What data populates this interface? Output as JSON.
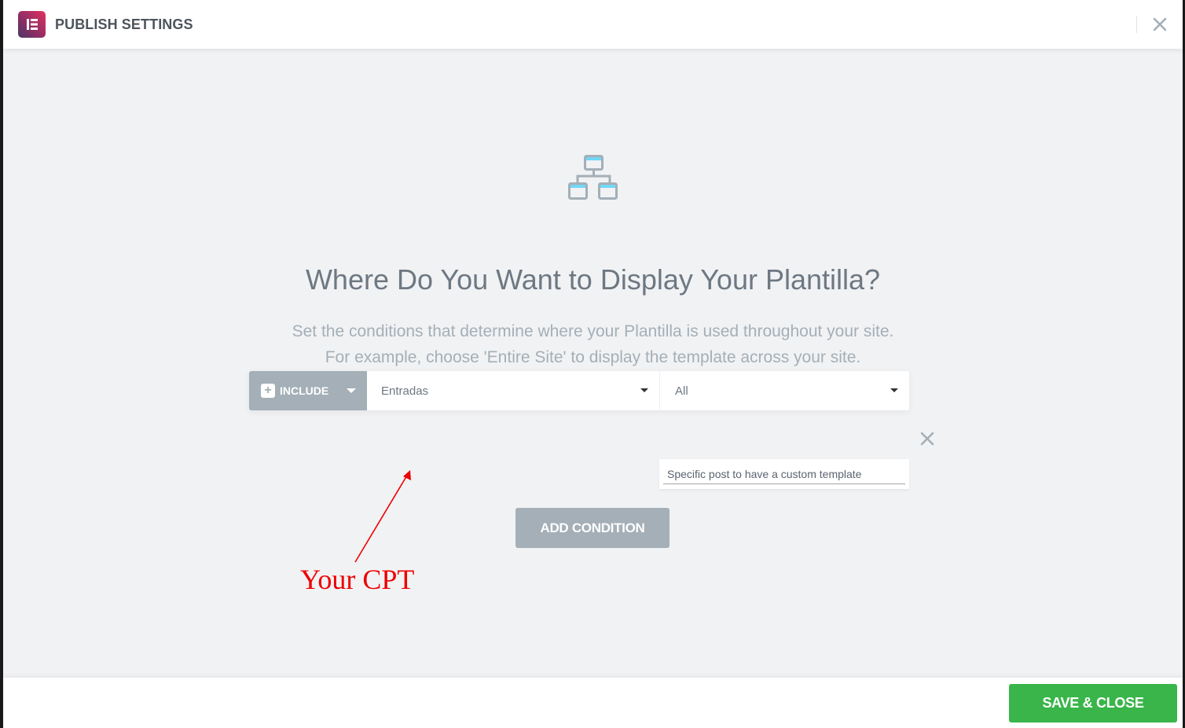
{
  "header": {
    "title": "PUBLISH SETTINGS",
    "logo_icon": "elementor-logo-icon",
    "close_icon": "close-icon"
  },
  "main": {
    "illustration_icon": "sitemap-hierarchy-icon",
    "heading": "Where Do You Want to Display Your Plantilla?",
    "description_line1": "Set the conditions that determine where your Plantilla is used throughout your site.",
    "description_line2": "For example, choose 'Entire Site' to display the template across your site."
  },
  "condition": {
    "include_label": "INCLUDE",
    "type_value": "Entradas",
    "subtype_value": "All",
    "search_value": "Specific post to have a custom template"
  },
  "actions": {
    "add_condition_label": "ADD CONDITION",
    "save_close_label": "SAVE & CLOSE"
  },
  "annotation": {
    "text": "Your CPT"
  },
  "colors": {
    "accent_gray": "#a4afb7",
    "save_green": "#39b54a",
    "annotation_red": "#ee0000"
  }
}
